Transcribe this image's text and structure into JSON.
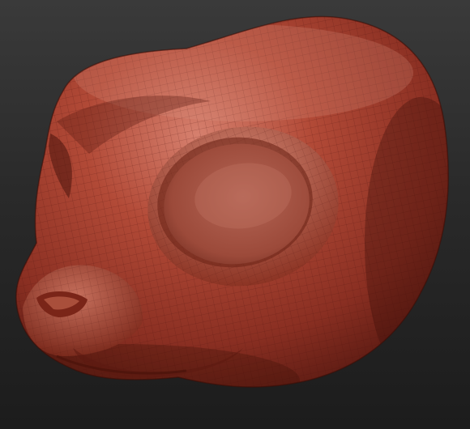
{
  "scene": {
    "subject": "sculpted-animal-head-model",
    "colors": {
      "background_top": "#3a3a3a",
      "background_bottom": "#1c1c1c",
      "clay_base": "#a8402e",
      "clay_highlight": "#d98a78",
      "clay_shadow": "#5a1a12",
      "wireframe": "#4a130c"
    }
  }
}
